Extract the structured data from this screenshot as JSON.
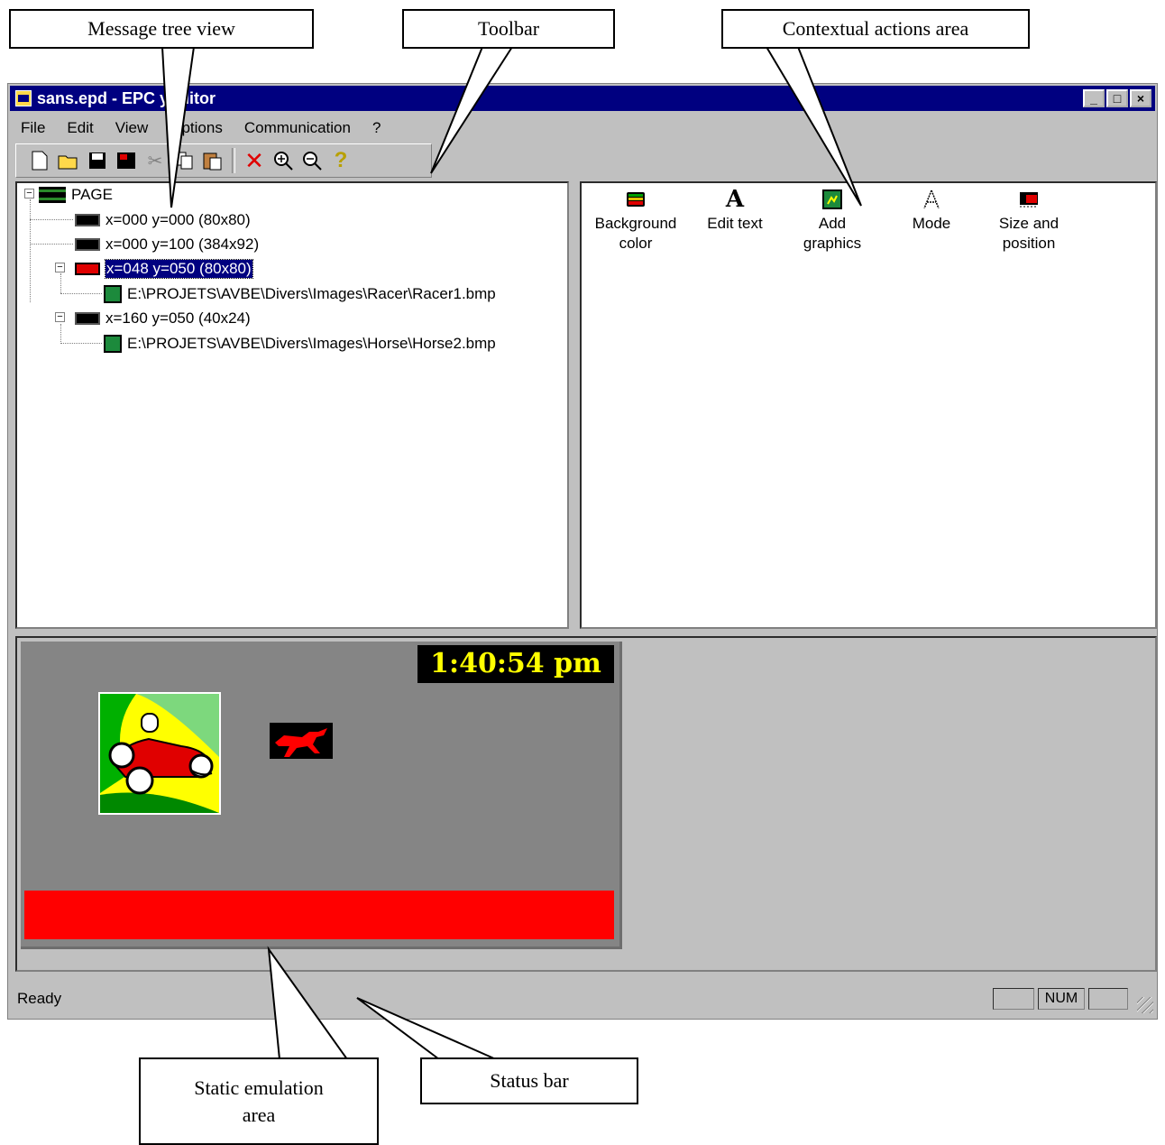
{
  "window": {
    "title": "sans.epd - EPC yEditor",
    "controls": {
      "minimize": "_",
      "maximize": "□",
      "close": "×"
    }
  },
  "menu": [
    {
      "label": "File"
    },
    {
      "label": "Edit"
    },
    {
      "label": "View"
    },
    {
      "label": "Options"
    },
    {
      "label": "Communication"
    },
    {
      "label": "?"
    }
  ],
  "toolbar": {
    "buttons": [
      "new",
      "open",
      "save",
      "print",
      "cut",
      "copy",
      "paste",
      "delete",
      "zoom-in",
      "zoom-out",
      "help"
    ]
  },
  "tree": {
    "root": "PAGE",
    "items": [
      {
        "label": "x=000 y=000 (80x80)"
      },
      {
        "label": "x=000 y=100 (384x92)"
      },
      {
        "label": "x=048 y=050 (80x80)",
        "selected": true
      },
      {
        "label": "E:\\PROJETS\\AVBE\\Divers\\Images\\Racer\\Racer1.bmp"
      },
      {
        "label": "x=160 y=050 (40x24)"
      },
      {
        "label": "E:\\PROJETS\\AVBE\\Divers\\Images\\Horse\\Horse2.bmp"
      }
    ]
  },
  "actions": [
    {
      "label": "Background\ncolor",
      "icon": "background-color-icon"
    },
    {
      "label": "Edit text",
      "icon": "edit-text-icon"
    },
    {
      "label": "Add\ngraphics",
      "icon": "add-graphics-icon"
    },
    {
      "label": "Mode",
      "icon": "mode-icon"
    },
    {
      "label": "Size and\nposition",
      "icon": "size-position-icon"
    }
  ],
  "emulation": {
    "clock": "1:40:54 pm",
    "colors": {
      "screen": "#858585",
      "clock_text": "#ffff00",
      "bar": "#ff0000"
    }
  },
  "statusbar": {
    "text": "Ready",
    "panels": [
      "",
      "NUM",
      ""
    ]
  },
  "callouts": {
    "tree": "Message tree view",
    "toolbar": "Toolbar",
    "actions": "Contextual actions area",
    "emulation": "Static emulation\narea",
    "status": "Status bar"
  }
}
